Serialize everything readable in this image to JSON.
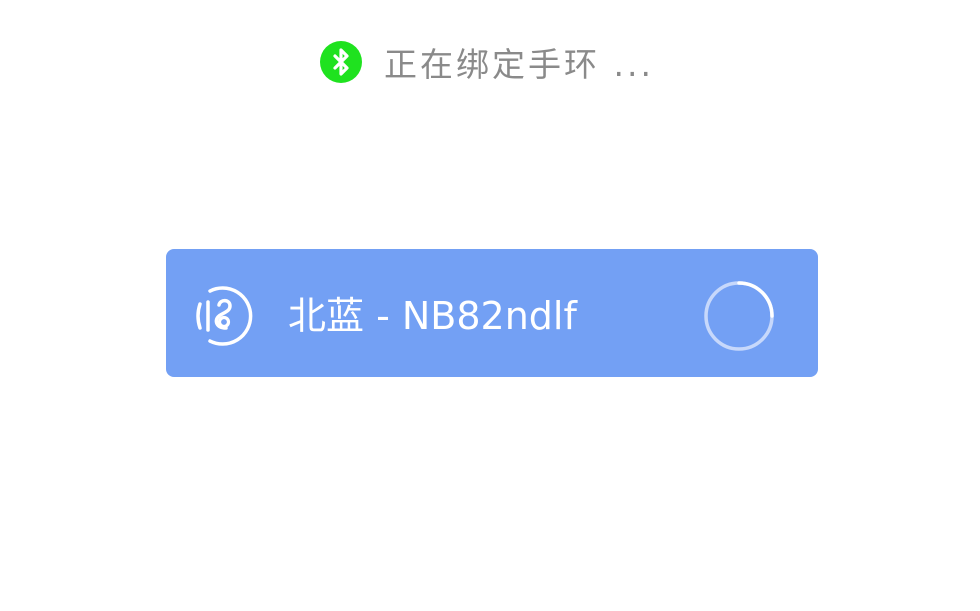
{
  "status": {
    "icon": "bluetooth-icon",
    "text": "正在绑定手环 ...",
    "badge_color": "#1fe21f"
  },
  "device": {
    "icon": "wristband-icon",
    "name": "北蓝 - NB82ndlf",
    "card_color": "#73a0f4",
    "progress_icon": "loading-spinner-icon"
  }
}
